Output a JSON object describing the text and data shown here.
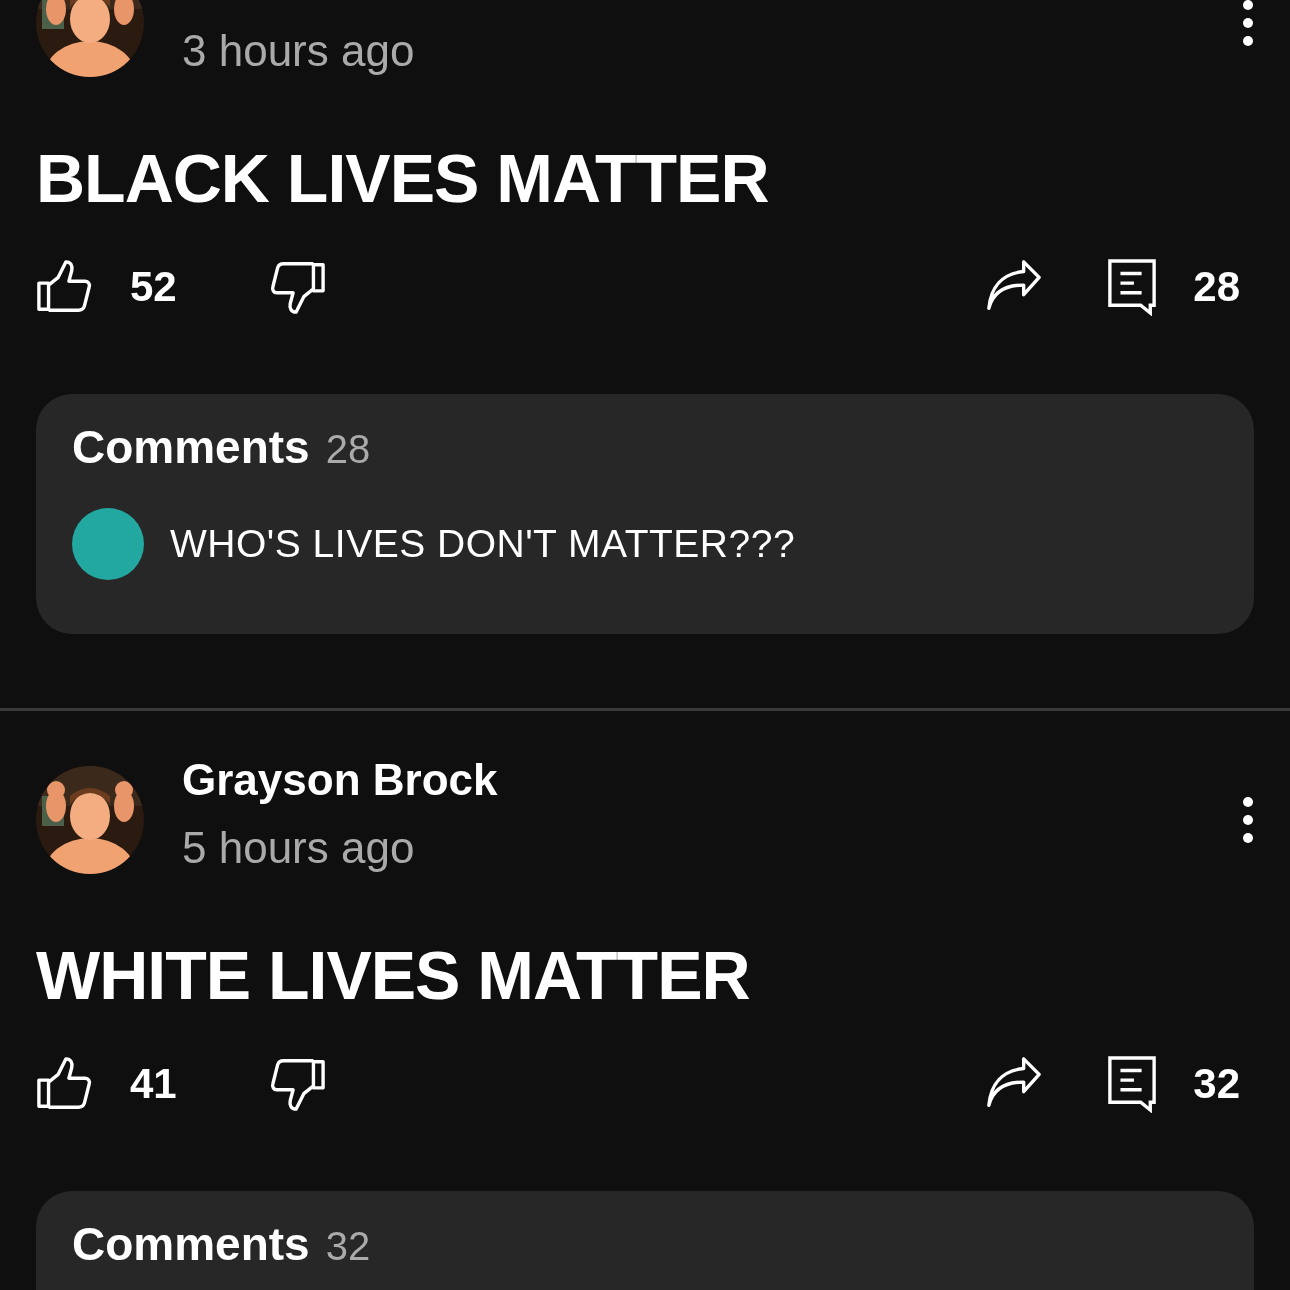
{
  "posts": [
    {
      "time": "3 hours ago",
      "text": "BLACK LIVES MATTER",
      "likes": "52",
      "comment_count": "28",
      "comments": {
        "title": "Comments",
        "count": "28",
        "items": [
          {
            "text": "WHO'S LIVES DON'T MATTER???"
          }
        ]
      }
    },
    {
      "author": "Grayson Brock",
      "time": "5 hours ago",
      "text": "WHITE LIVES MATTER",
      "likes": "41",
      "comment_count": "32",
      "comments": {
        "title": "Comments",
        "count": "32"
      }
    }
  ]
}
